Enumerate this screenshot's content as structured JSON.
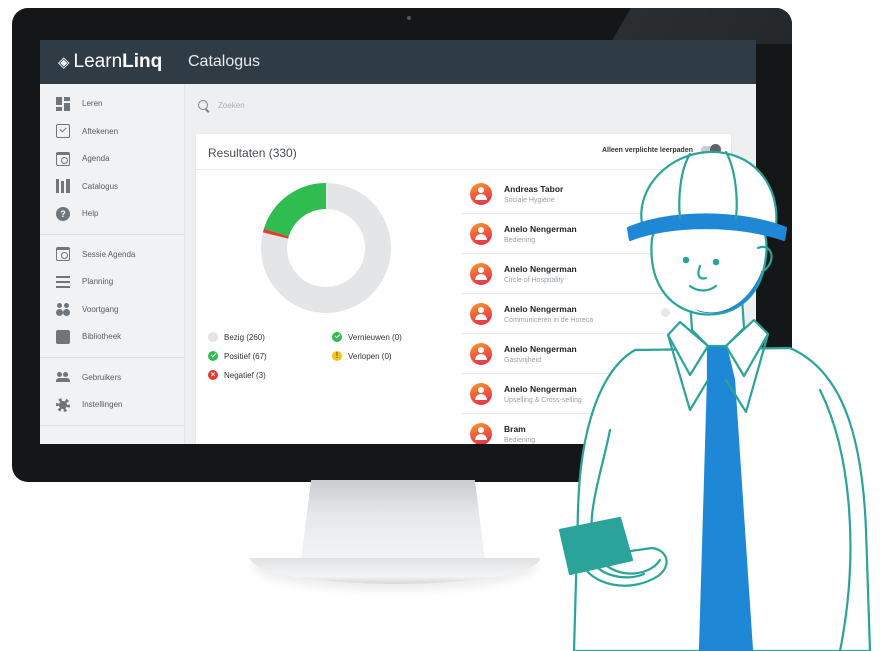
{
  "app": {
    "brand_light": "Learn",
    "brand_bold": "Linq",
    "page_title": "Catalogus"
  },
  "sidebar": {
    "group1": [
      {
        "label": "Leren",
        "icon": "dashboard-icon"
      },
      {
        "label": "Aftekenen",
        "icon": "checkbox-icon"
      },
      {
        "label": "Agenda",
        "icon": "calendar-icon"
      },
      {
        "label": "Catalogus",
        "icon": "books-icon"
      },
      {
        "label": "Help",
        "icon": "help-icon"
      }
    ],
    "group2": [
      {
        "label": "Sessie Agenda",
        "icon": "calendar-icon"
      },
      {
        "label": "Planning",
        "icon": "list-icon"
      },
      {
        "label": "Voortgang",
        "icon": "progress-icon"
      },
      {
        "label": "Bibliotheek",
        "icon": "library-icon"
      }
    ],
    "group3": [
      {
        "label": "Gebruikers",
        "icon": "users-icon"
      },
      {
        "label": "Instellingen",
        "icon": "gear-icon"
      }
    ]
  },
  "search": {
    "placeholder": "Zoeken"
  },
  "results": {
    "title": "Resultaten (330)",
    "toggle_label": "Alleen verplichte leerpaden",
    "toggle_on": false
  },
  "chart_data": {
    "type": "pie",
    "categories": [
      "Bezig",
      "Positief",
      "Negatief",
      "Vernieuwen",
      "Verlopen"
    ],
    "values": [
      260,
      67,
      3,
      0,
      0
    ],
    "colors": [
      "#e3e5e7",
      "#2ebd4e",
      "#e53935",
      "#2ebd4e",
      "#f5c518"
    ],
    "donut": true
  },
  "legend": [
    {
      "label": "Bezig (260)",
      "kind": "grey"
    },
    {
      "label": "Vernieuwen (0)",
      "kind": "green"
    },
    {
      "label": "Positief (67)",
      "kind": "green"
    },
    {
      "label": "Verlopen (0)",
      "kind": "yellow"
    },
    {
      "label": "Negatief (3)",
      "kind": "red"
    }
  ],
  "people": [
    {
      "name": "Andreas Tabor",
      "course": "Sociale Hygiëne"
    },
    {
      "name": "Anelo Nengerman",
      "course": "Bediening"
    },
    {
      "name": "Anelo Nengerman",
      "course": "Circle of Hospitality"
    },
    {
      "name": "Anelo Nengerman",
      "course": "Communiceren in de Horeca"
    },
    {
      "name": "Anelo Nengerman",
      "course": "Gastvrijheid"
    },
    {
      "name": "Anelo Nengerman",
      "course": "Upselling & Cross-selling"
    },
    {
      "name": "Bram",
      "course": "Bediening"
    }
  ],
  "colors": {
    "topbar": "#2f3b45",
    "accent_teal": "#2aa39a",
    "accent_blue": "#1e88d6"
  }
}
